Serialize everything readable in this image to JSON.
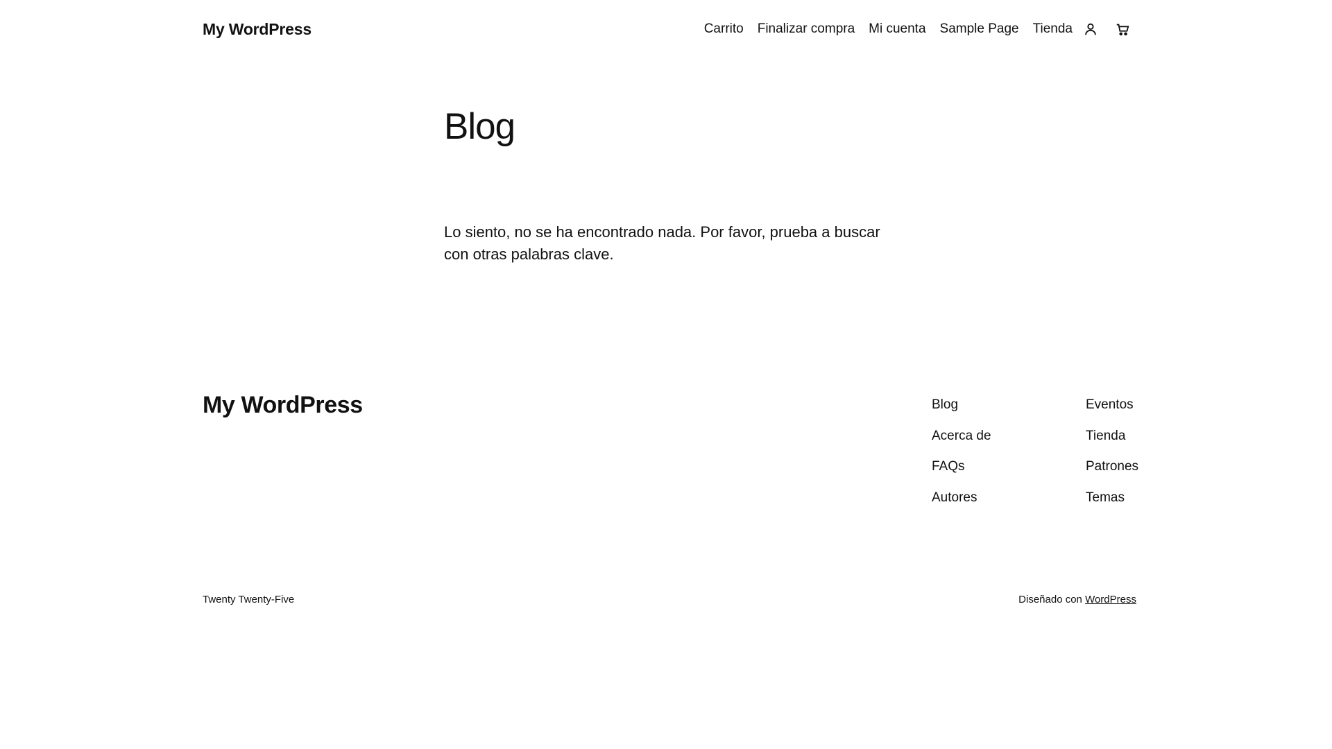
{
  "header": {
    "site_title": "My WordPress",
    "nav": [
      {
        "label": "Carrito"
      },
      {
        "label": "Finalizar compra"
      },
      {
        "label": "Mi cuenta"
      },
      {
        "label": "Sample Page"
      },
      {
        "label": "Tienda"
      }
    ],
    "icons": {
      "account": "user-icon",
      "cart": "cart-icon"
    }
  },
  "main": {
    "title": "Blog",
    "message": "Lo siento, no se ha encontrado nada. Por favor, prueba a buscar con otras palabras clave."
  },
  "footer": {
    "site_title": "My WordPress",
    "column_1": [
      {
        "label": "Blog"
      },
      {
        "label": "Acerca de"
      },
      {
        "label": "FAQs"
      },
      {
        "label": "Autores"
      }
    ],
    "column_2": [
      {
        "label": "Eventos"
      },
      {
        "label": "Tienda"
      },
      {
        "label": "Patrones"
      },
      {
        "label": "Temas"
      }
    ],
    "theme_name": "Twenty Twenty-Five",
    "credit_prefix": "Diseñado con ",
    "credit_link": "WordPress"
  }
}
